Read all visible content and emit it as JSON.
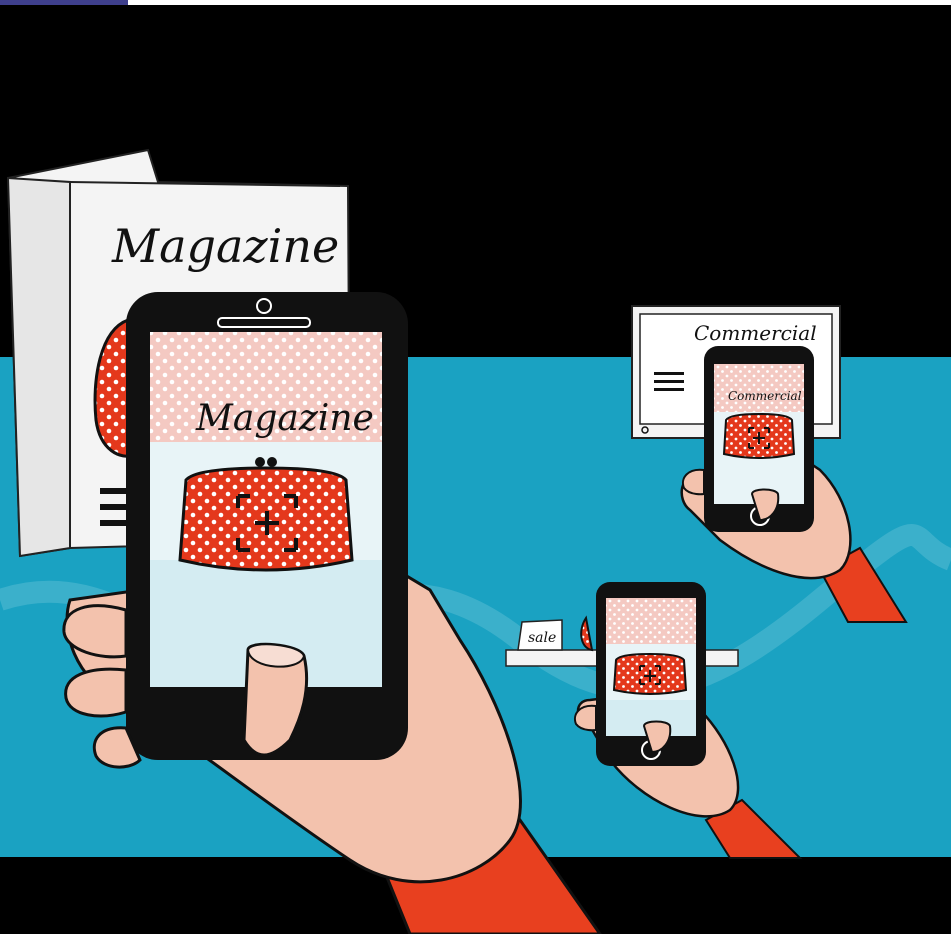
{
  "scene": {
    "magazine_title": "Magazine",
    "phone_screen_title": "Magazine",
    "tv_title": "Commercial",
    "tv_phone_title": "Commercial",
    "sale_tag": "sale"
  },
  "colors": {
    "background_top": "#000000",
    "background_band": "#1aa2c2",
    "sleeve": "#e8401f",
    "skin": "#f3c2ad",
    "purse": "#e4381c",
    "phone": "#111111",
    "screen_light": "#cfe9f0"
  },
  "icons": [
    "scan-target-icon",
    "home-button-icon",
    "power-icon",
    "menu-lines-icon"
  ]
}
